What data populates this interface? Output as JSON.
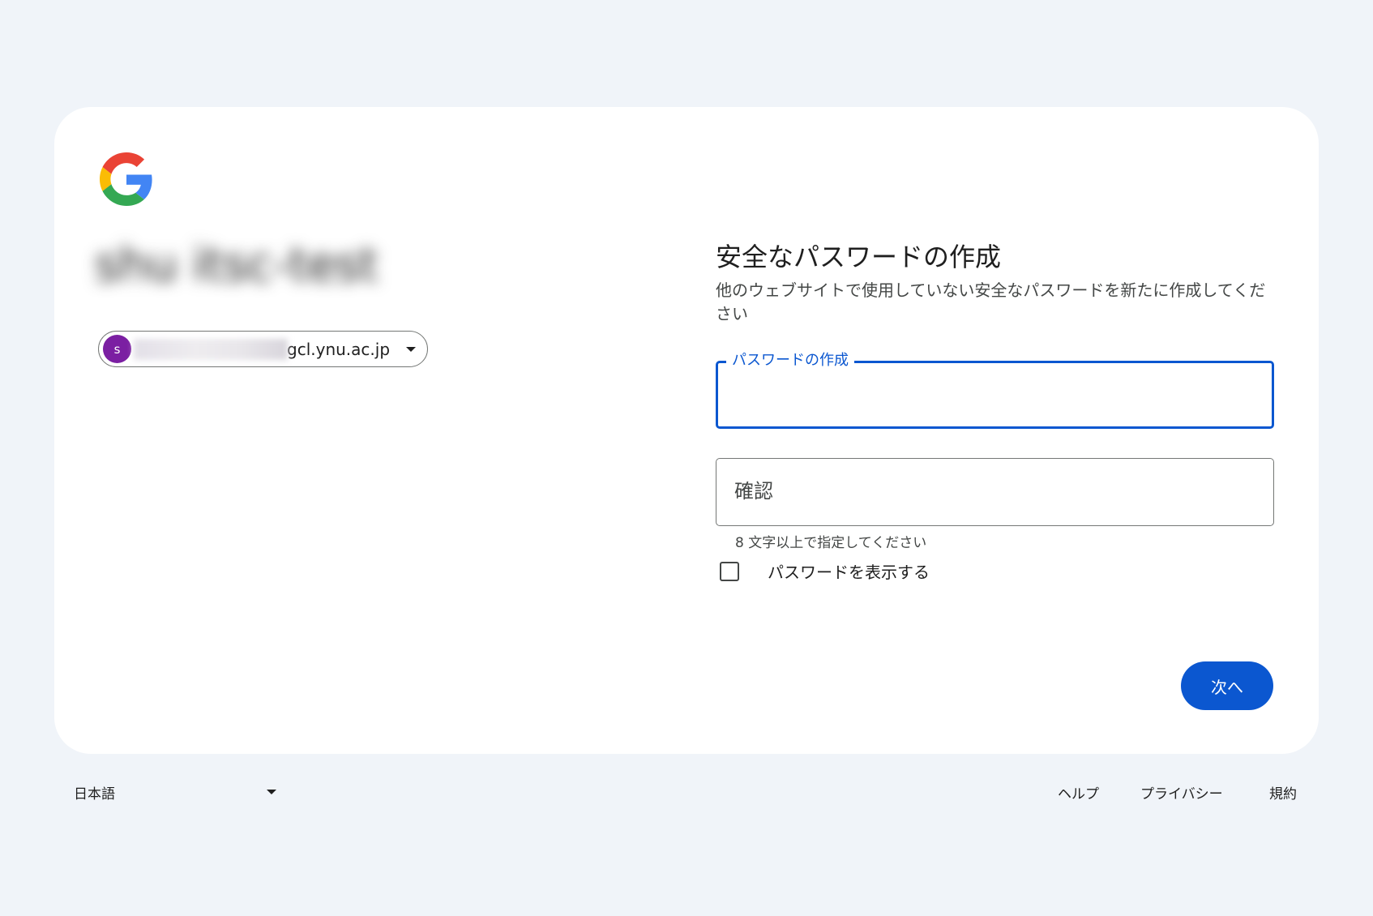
{
  "account": {
    "name": "shu itsc-test",
    "avatar_letter": "s",
    "email_domain": "gcl.ynu.ac.jp",
    "avatar_color": "#7b1fa2"
  },
  "main": {
    "title": "安全なパスワードの作成",
    "subtitle": "他のウェブサイトで使用していない安全なパスワードを新たに作成してください",
    "create_field": {
      "label": "パスワードの作成",
      "value": ""
    },
    "confirm_field": {
      "label": "確認",
      "value": ""
    },
    "hint": "8 文字以上で指定してください",
    "show_password_label": "パスワードを表示する",
    "next_label": "次へ"
  },
  "footer": {
    "language": "日本語",
    "help": "ヘルプ",
    "privacy": "プライバシー",
    "terms": "規約"
  },
  "colors": {
    "page_background": "#f0f4f9",
    "card_background": "#ffffff",
    "accent": "#0b57d0",
    "google_blue": "#4285f4",
    "google_red": "#ea4335",
    "google_yellow": "#fbbc05",
    "google_green": "#34a853"
  },
  "icons": {
    "logo": "google-g-logo-icon",
    "account_dropdown": "caret-down-icon",
    "language_dropdown": "caret-down-icon"
  }
}
